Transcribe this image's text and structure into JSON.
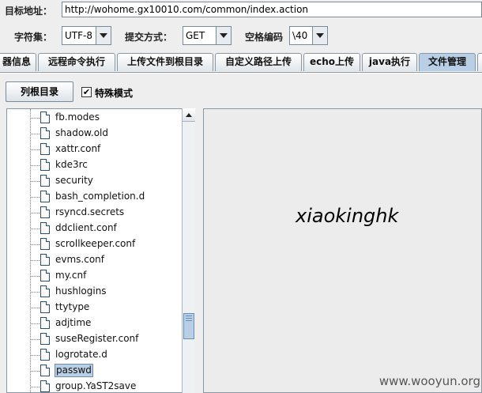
{
  "target": {
    "label": "目标地址：",
    "url": "http://wohome.gx10010.com/common/index.action"
  },
  "charset": {
    "label": "字符集：",
    "value": "UTF-8"
  },
  "method": {
    "label": "提交方式：",
    "value": "GET"
  },
  "space": {
    "label": "空格编码",
    "value": "\\40"
  },
  "tabs": [
    {
      "label": "器信息",
      "active": false
    },
    {
      "label": "远程命令执行",
      "active": false
    },
    {
      "label": "上传文件到根目录",
      "active": false
    },
    {
      "label": "自定义路径上传",
      "active": false
    },
    {
      "label": "echo上传",
      "active": false
    },
    {
      "label": "java执行",
      "active": false
    },
    {
      "label": "文件管理",
      "active": true
    }
  ],
  "toolbar": {
    "list_root_label": "列根目录",
    "special_mode_label": "特殊模式",
    "special_mode_checked": true
  },
  "tree": {
    "items": [
      {
        "label": "fb.modes",
        "selected": false
      },
      {
        "label": "shadow.old",
        "selected": false
      },
      {
        "label": "xattr.conf",
        "selected": false
      },
      {
        "label": "kde3rc",
        "selected": false
      },
      {
        "label": "security",
        "selected": false
      },
      {
        "label": "bash_completion.d",
        "selected": false
      },
      {
        "label": "rsyncd.secrets",
        "selected": false
      },
      {
        "label": "ddclient.conf",
        "selected": false
      },
      {
        "label": "scrollkeeper.conf",
        "selected": false
      },
      {
        "label": "evms.conf",
        "selected": false
      },
      {
        "label": "my.cnf",
        "selected": false
      },
      {
        "label": "hushlogins",
        "selected": false
      },
      {
        "label": "ttytype",
        "selected": false
      },
      {
        "label": "adjtime",
        "selected": false
      },
      {
        "label": "suseRegister.conf",
        "selected": false
      },
      {
        "label": "logrotate.d",
        "selected": false
      },
      {
        "label": "passwd",
        "selected": true
      },
      {
        "label": "group.YaST2save",
        "selected": false
      }
    ]
  },
  "content": {
    "text": "xiaokinghk"
  },
  "watermark": "www.wooyun.org"
}
